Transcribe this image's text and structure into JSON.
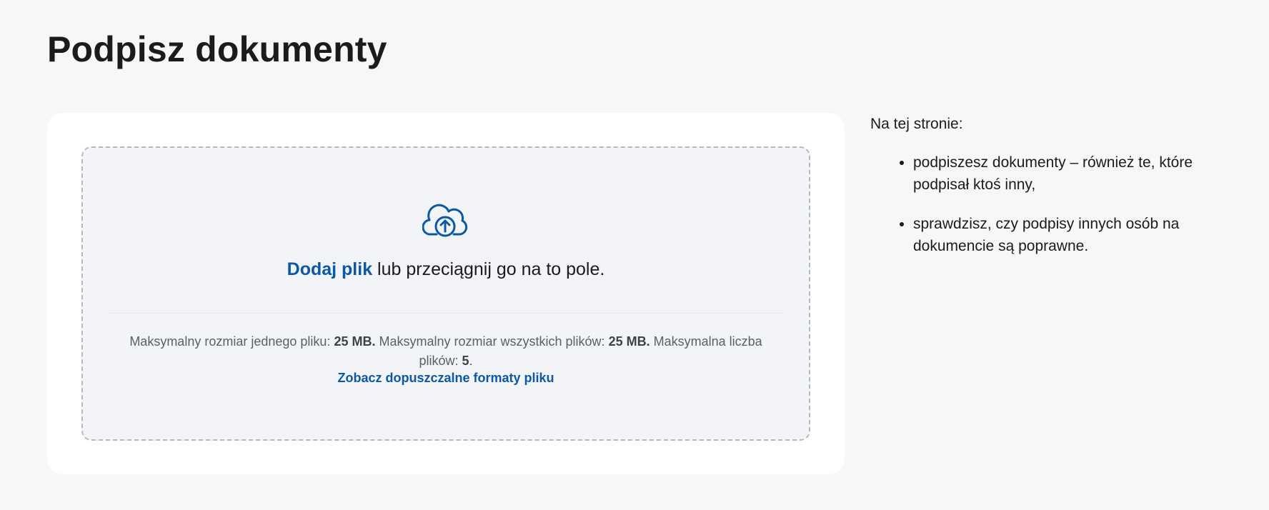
{
  "page": {
    "title": "Podpisz dokumenty"
  },
  "upload": {
    "icon": "cloud-upload-icon",
    "add_file_label": "Dodaj plik",
    "drop_text": " lub przeciągnij go na to pole.",
    "limits": {
      "single_label": "Maksymalny rozmiar jednego pliku:",
      "single_value": "25 MB.",
      "total_label": "Maksymalny rozmiar wszystkich plików:",
      "total_value": "25 MB.",
      "count_label": "Maksymalna liczba plików:",
      "count_value": "5",
      "count_suffix": "."
    },
    "formats_link": "Zobacz dopuszczalne formaty pliku"
  },
  "aside": {
    "intro": "Na tej stronie:",
    "items": [
      "podpiszesz dokumenty – również te, które podpisał ktoś inny,",
      "sprawdzisz, czy podpisy innych osób na dokumencie są poprawne."
    ]
  },
  "colors": {
    "accent": "#0b59a6",
    "background": "#f6f7f9",
    "card": "#ffffff",
    "dropzone": "#f3f4f8"
  }
}
